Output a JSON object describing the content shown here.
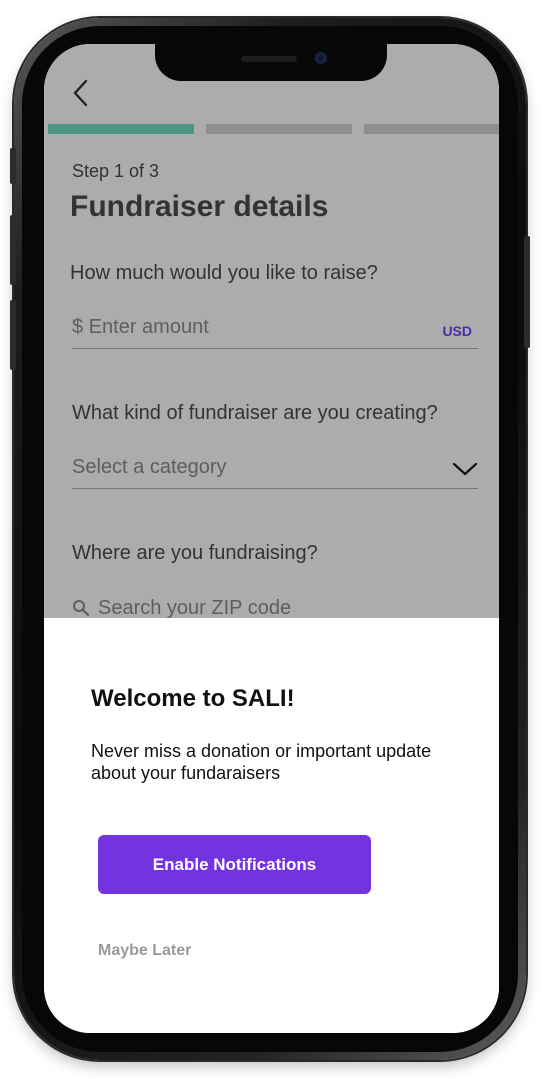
{
  "header": {
    "back_icon": "chevron-left-icon"
  },
  "progress": {
    "steps_total": 3,
    "current_step": 1,
    "active_color": "#4f9585",
    "inactive_color": "#8e8e8e"
  },
  "form": {
    "step_label": "Step 1 of 3",
    "title": "Fundraiser details",
    "amount": {
      "question": "How much would you like to raise?",
      "placeholder": "$ Enter amount",
      "currency": "USD"
    },
    "category": {
      "question": "What kind of fundraiser are you creating?",
      "placeholder": "Select a category",
      "icon": "chevron-down-icon"
    },
    "location": {
      "question": "Where are you fundraising?",
      "placeholder": "Search your ZIP code",
      "icon": "search-icon"
    }
  },
  "sheet": {
    "title": "Welcome to SALI!",
    "body": "Never miss a donation or important update about your fundaraisers",
    "primary_button": "Enable Notifications",
    "secondary_link": "Maybe Later"
  },
  "colors": {
    "accent": "#7333df",
    "overlay": "#acacac",
    "currency_text": "#4a2ea8"
  }
}
